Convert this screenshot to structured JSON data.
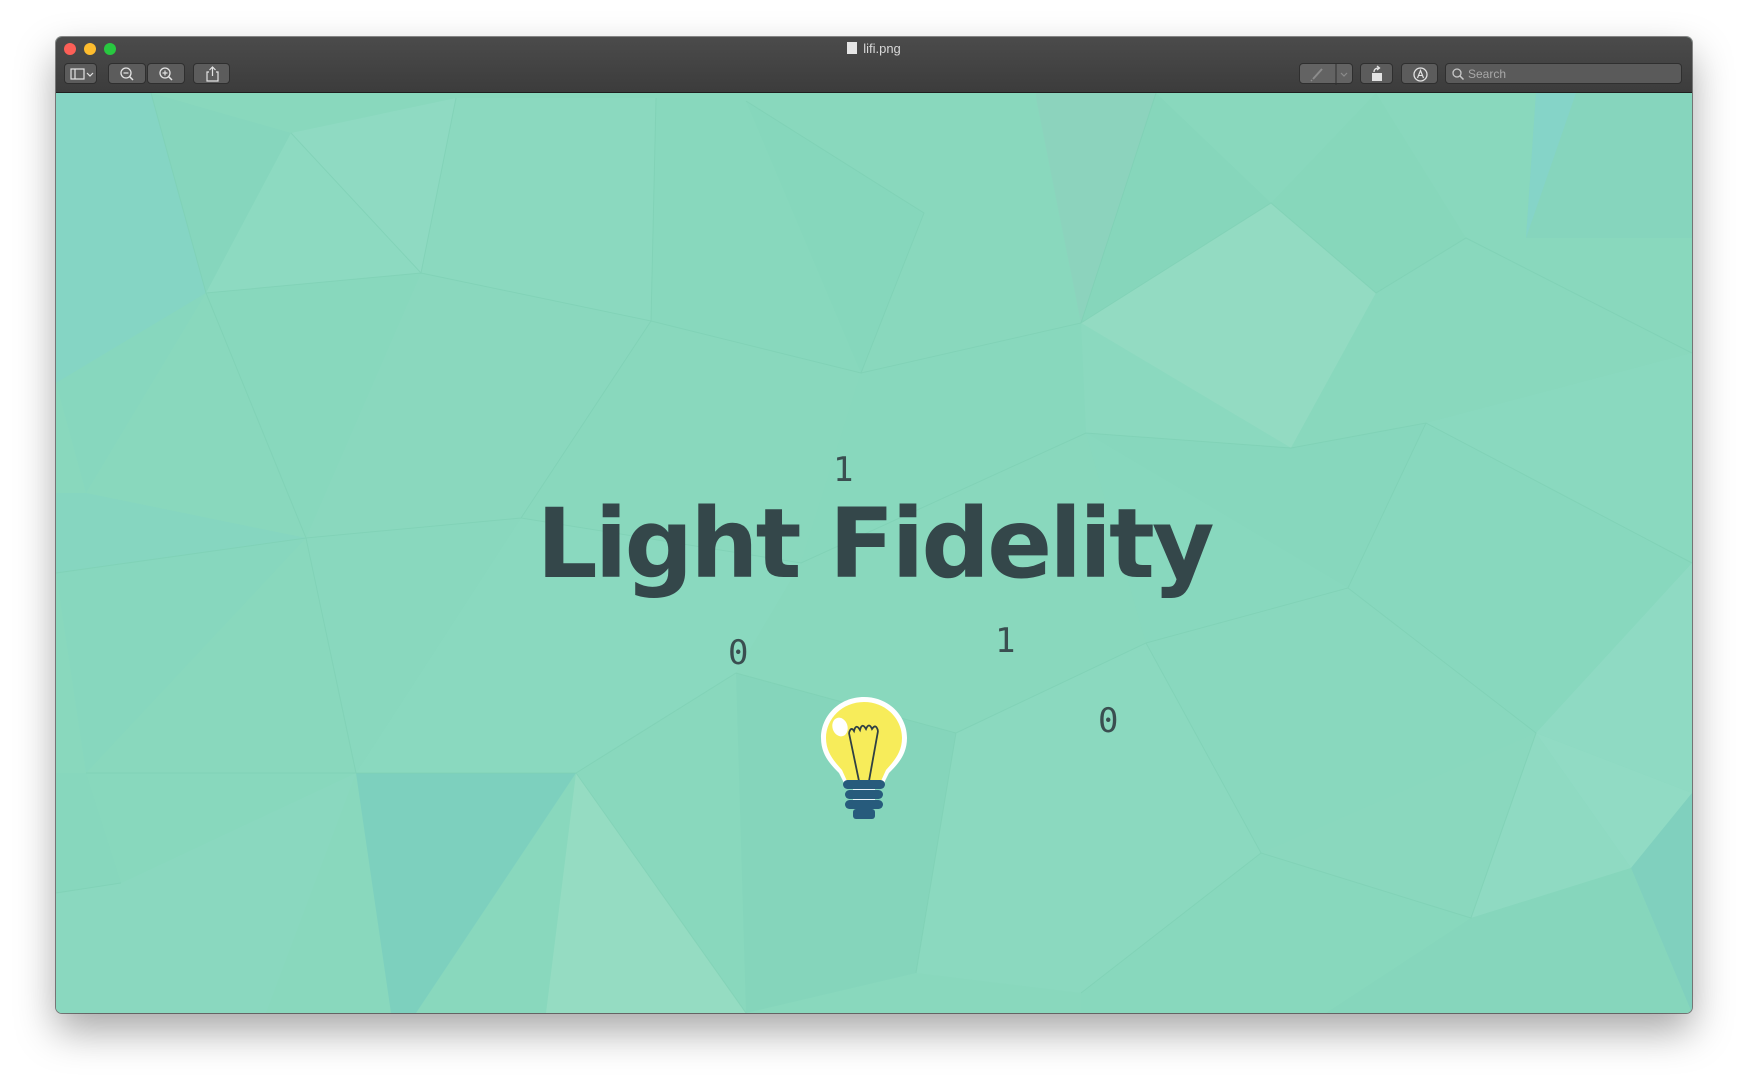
{
  "window": {
    "title": "lifi.png"
  },
  "toolbar": {
    "sidebar_icon": "sidebar-toggle-icon",
    "zoom_out_icon": "zoom-out-icon",
    "zoom_in_icon": "zoom-in-icon",
    "share_icon": "share-icon",
    "markup_icon": "pen-icon",
    "rotate_icon": "rotate-icon",
    "annotate_icon": "markup-circle-icon",
    "search_placeholder": "Search"
  },
  "image": {
    "headline": "Light Fidelity",
    "digits": [
      "1",
      "0",
      "1",
      "0"
    ],
    "bulb_icon": "lightbulb-icon"
  },
  "colors": {
    "background": "#89d8bd",
    "headline": "#34474a",
    "bulb": "#f7ec5a",
    "bulb_base": "#275b7c"
  }
}
